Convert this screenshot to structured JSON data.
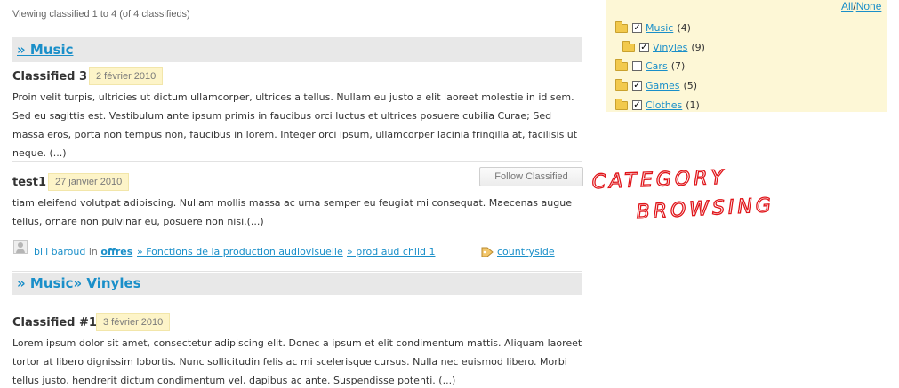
{
  "listing": {
    "viewing_text": "Viewing classified 1 to 4 (of 4 classifieds)",
    "follow_button": "Follow Classified",
    "sections": [
      {
        "title": "» Music"
      },
      {
        "title": "» Music» Vinyles"
      }
    ],
    "items": [
      {
        "title": "Classified 3",
        "date": "2 février 2010",
        "lines": [
          "Proin velit turpis, ultricies ut dictum ullamcorper, ultrices a tellus. Nullam eu justo a elit laoreet molestie in id sem.",
          "Sed eu sagittis est. Vestibulum ante ipsum primis in faucibus orci luctus et ultrices posuere cubilia Curae; Sed",
          "massa eros, porta non tempus non, faucibus in lorem. Integer orci ipsum, ullamcorper lacinia fringilla at, facilisis ut",
          "neque. (...)"
        ]
      },
      {
        "title": "test1",
        "date": "27 janvier 2010",
        "lines": [
          "tiam eleifend volutpat adipiscing. Nullam mollis massa ac urna semper eu feugiat mi consequat. Maecenas augue",
          "tellus, ornare non pulvinar eu, posuere non nisi.(...)"
        ],
        "meta": {
          "author": "bill baroud",
          "in": "in",
          "category": "offres",
          "crumb1": "» Fonctions de la production audiovisuelle",
          "crumb2": "» prod aud child 1",
          "tag": "countryside"
        }
      },
      {
        "title": "Classified #1",
        "date": "3 février 2010",
        "lines": [
          "Lorem ipsum dolor sit amet, consectetur adipiscing elit. Donec a ipsum et elit condimentum mattis. Aliquam laoreet",
          "tortor at libero dignissim lobortis. Nunc sollicitudin felis ac mi scelerisque cursus. Nulla nec euismod libero. Morbi",
          "tellus justo, hendrerit dictum condimentum vel, dapibus ac ante. Suspendisse potenti. (...)"
        ]
      }
    ]
  },
  "sidebar": {
    "all": "All",
    "slash": "/",
    "none": "None",
    "categories": [
      {
        "label": "Music",
        "count": "(4)",
        "checked": true
      },
      {
        "label": "Vinyles",
        "count": "(9)",
        "checked": true
      },
      {
        "label": "Cars",
        "count": "(7)",
        "checked": false
      },
      {
        "label": "Games",
        "count": "(5)",
        "checked": true
      },
      {
        "label": "Clothes",
        "count": "(1)",
        "checked": true
      }
    ]
  },
  "annotation": {
    "line1": "CATEGORY",
    "line2": "BROWSING",
    "color": "#e0151a"
  }
}
